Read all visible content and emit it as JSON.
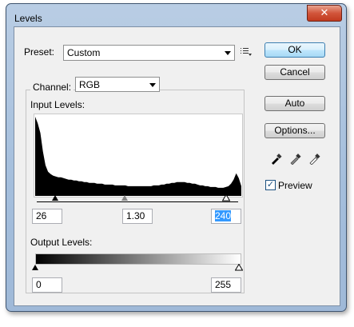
{
  "window": {
    "title": "Levels",
    "close_glyph": "✕"
  },
  "preset": {
    "label": "Preset:",
    "value": "Custom"
  },
  "channel": {
    "label": "Channel:",
    "value": "RGB"
  },
  "input_levels": {
    "label": "Input Levels:",
    "black": "26",
    "gamma": "1.30",
    "white": "240"
  },
  "output_levels": {
    "label": "Output Levels:",
    "black": "0",
    "white": "255"
  },
  "buttons": {
    "ok": "OK",
    "cancel": "Cancel",
    "auto": "Auto",
    "options": "Options..."
  },
  "preview": {
    "label": "Preview",
    "checked": true
  },
  "histogram": {
    "heights": [
      0.98,
      0.9,
      0.78,
      0.55,
      0.38,
      0.3,
      0.27,
      0.25,
      0.24,
      0.23,
      0.23,
      0.22,
      0.21,
      0.2,
      0.2,
      0.19,
      0.19,
      0.18,
      0.18,
      0.17,
      0.17,
      0.16,
      0.16,
      0.16,
      0.15,
      0.15,
      0.15,
      0.14,
      0.14,
      0.14,
      0.14,
      0.13,
      0.13,
      0.13,
      0.13,
      0.13,
      0.12,
      0.12,
      0.12,
      0.12,
      0.12,
      0.12,
      0.12,
      0.12,
      0.12,
      0.12,
      0.13,
      0.13,
      0.13,
      0.14,
      0.14,
      0.15,
      0.15,
      0.16,
      0.16,
      0.17,
      0.17,
      0.17,
      0.17,
      0.16,
      0.16,
      0.15,
      0.15,
      0.14,
      0.13,
      0.13,
      0.12,
      0.12,
      0.11,
      0.11,
      0.11,
      0.1,
      0.1,
      0.1,
      0.11,
      0.12,
      0.15,
      0.2,
      0.28,
      0.22,
      0.12
    ]
  }
}
